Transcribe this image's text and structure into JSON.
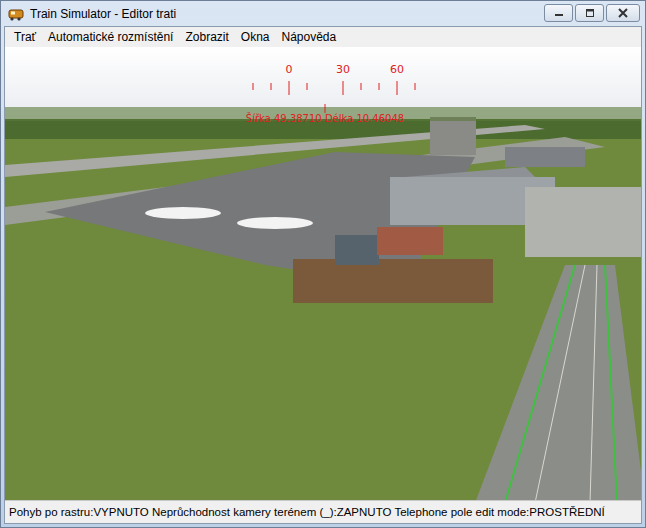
{
  "window": {
    "title": "Train Simulator - Editor trati"
  },
  "menu": [
    {
      "label": "Trať"
    },
    {
      "label": "Automatické rozmístění"
    },
    {
      "label": "Zobrazit"
    },
    {
      "label": "Okna"
    },
    {
      "label": "Nápověda"
    }
  ],
  "viewport": {
    "compass": {
      "labels": [
        "0",
        "30",
        "60"
      ]
    },
    "coordinates": "Šířka 49.38710 Délka 10.46048"
  },
  "status_bar": {
    "text": "Pohyb po rastru:VYPNUTO Neprůchodnost kamery terénem (_):ZAPNUTO Telephone pole edit mode:PROSTŘEDNÍ"
  }
}
